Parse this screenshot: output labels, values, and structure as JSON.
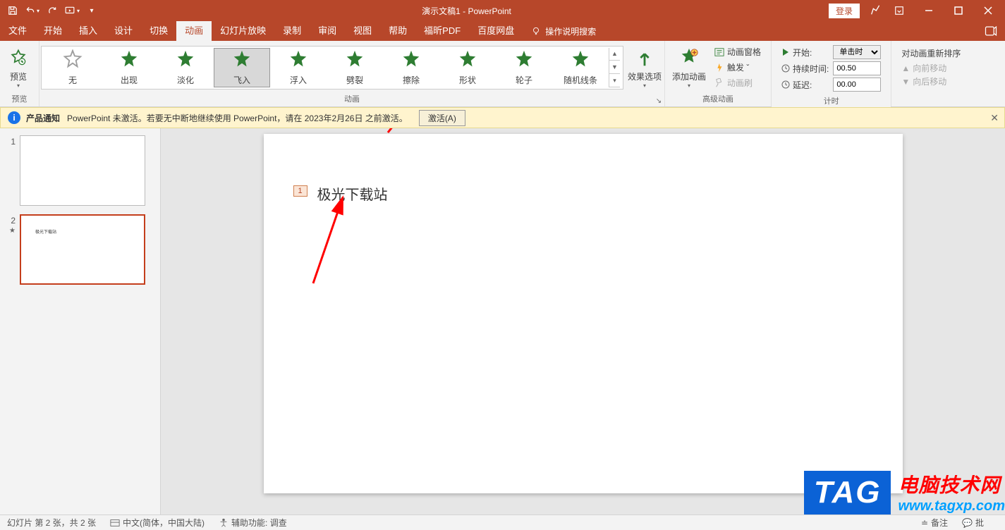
{
  "title": "演示文稿1  -  PowerPoint",
  "login": "登录",
  "tabs": [
    "文件",
    "开始",
    "插入",
    "设计",
    "切换",
    "动画",
    "幻灯片放映",
    "录制",
    "审阅",
    "视图",
    "帮助",
    "福昕PDF",
    "百度网盘"
  ],
  "active_tab": "动画",
  "tell_me": "操作说明搜索",
  "ribbon": {
    "preview": {
      "label": "预览",
      "group": "预览"
    },
    "animations": {
      "group": "动画",
      "items": [
        {
          "key": "none",
          "label": "无",
          "color": "#9e9e9e"
        },
        {
          "key": "appear",
          "label": "出现",
          "color": "#2e7d32"
        },
        {
          "key": "fade",
          "label": "淡化",
          "color": "#2e7d32"
        },
        {
          "key": "flyin",
          "label": "飞入",
          "color": "#2e7d32",
          "selected": true
        },
        {
          "key": "floatin",
          "label": "浮入",
          "color": "#2e7d32"
        },
        {
          "key": "split",
          "label": "劈裂",
          "color": "#2e7d32"
        },
        {
          "key": "wipe",
          "label": "擦除",
          "color": "#2e7d32"
        },
        {
          "key": "shape",
          "label": "形状",
          "color": "#2e7d32"
        },
        {
          "key": "wheel",
          "label": "轮子",
          "color": "#2e7d32"
        },
        {
          "key": "randombars",
          "label": "随机线条",
          "color": "#2e7d32"
        }
      ],
      "effect_options": "效果选项"
    },
    "advanced": {
      "group": "高级动画",
      "add": "添加动画",
      "pane": "动画窗格",
      "trigger": "触发 ˇ",
      "painter": "动画刷"
    },
    "timing": {
      "group": "计时",
      "start_label": "开始:",
      "start_value": "单击时",
      "duration_label": "持续时间:",
      "duration_value": "00.50",
      "delay_label": "延迟:",
      "delay_value": "00.00"
    },
    "reorder": {
      "title": "对动画重新排序",
      "up": "向前移动",
      "down": "向后移动"
    }
  },
  "notification": {
    "badge": "产品通知",
    "text": "PowerPoint 未激活。若要无中断地继续使用 PowerPoint，请在 2023年2月26日 之前激活。",
    "button": "激活(A)"
  },
  "thumbnails": [
    {
      "num": "1",
      "selected": false,
      "text": ""
    },
    {
      "num": "2",
      "selected": true,
      "text": "极光下载站",
      "hasAnim": true
    }
  ],
  "slide": {
    "anim_index": "1",
    "text": "极光下载站"
  },
  "statusbar": {
    "slide_info": "幻灯片 第 2 张，共 2 张",
    "lang": "中文(简体，中国大陆)",
    "a11y": "辅助功能: 调查",
    "notes": "备注",
    "comments": "批"
  },
  "watermark": {
    "tag": "TAG",
    "line1": "电脑技术网",
    "line2": "www.tagxp.com"
  }
}
